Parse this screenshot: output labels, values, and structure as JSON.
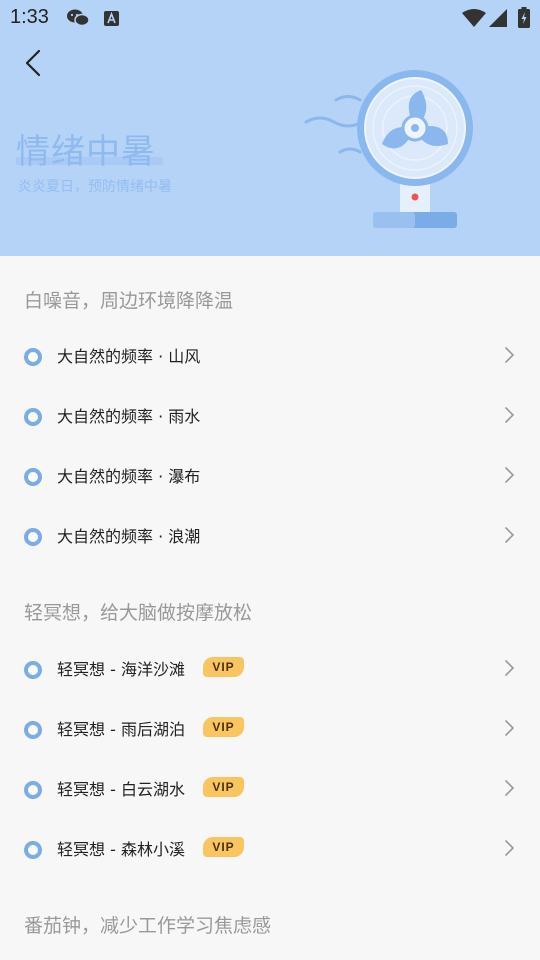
{
  "status_bar": {
    "time": "1:33",
    "icons": [
      "wechat-icon",
      "notification-a-icon",
      "wifi-icon",
      "signal-icon",
      "battery-charging-icon"
    ]
  },
  "header": {
    "back_icon": "chevron-left-icon",
    "title": "情绪中暑",
    "subtitle": "炎炎夏日，预防情绪中暑",
    "illustration": "electric-fan"
  },
  "sections": [
    {
      "title": "白噪音，周边环境降降温",
      "items": [
        {
          "label": "大自然的频率 · 山风",
          "vip": false
        },
        {
          "label": "大自然的频率 · 雨水",
          "vip": false
        },
        {
          "label": "大自然的频率 · 瀑布",
          "vip": false
        },
        {
          "label": "大自然的频率 · 浪潮",
          "vip": false
        }
      ]
    },
    {
      "title": "轻冥想，给大脑做按摩放松",
      "items": [
        {
          "label": "轻冥想 - 海洋沙滩",
          "vip": true,
          "vip_label": "VIP"
        },
        {
          "label": "轻冥想 - 雨后湖泊",
          "vip": true,
          "vip_label": "VIP"
        },
        {
          "label": "轻冥想 - 白云湖水",
          "vip": true,
          "vip_label": "VIP"
        },
        {
          "label": "轻冥想 - 森林小溪",
          "vip": true,
          "vip_label": "VIP"
        }
      ]
    },
    {
      "title": "番茄钟，减少工作学习焦虑感",
      "items": []
    }
  ],
  "colors": {
    "header_bg": "#b5d3f7",
    "accent": "#7aace8",
    "vip_bg": "#f8c560",
    "page_bg": "#f7f7f7"
  }
}
